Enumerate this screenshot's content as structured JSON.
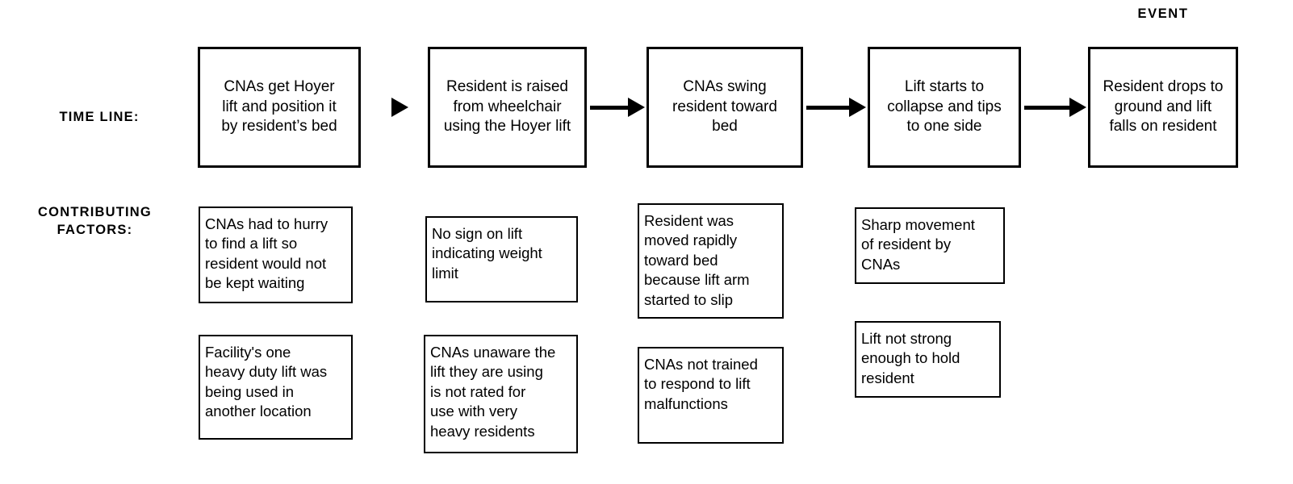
{
  "diagram": {
    "title_caption": "EVENT",
    "row_labels": {
      "timeline": "TIME LINE:",
      "contributing_factors": "CONTRIBUTING\nFACTORS:"
    },
    "colors": {
      "background": "#ffffff",
      "stroke": "#000000",
      "text": "#000000"
    },
    "timeline": {
      "steps": [
        {
          "id": "step-1",
          "text": "CNAs get Hoyer\nlift and position it\nby resident’s bed"
        },
        {
          "id": "step-2",
          "text": "Resident is raised\nfrom wheelchair\nusing the Hoyer lift"
        },
        {
          "id": "step-3",
          "text": "CNAs swing\nresident toward\nbed"
        },
        {
          "id": "step-4",
          "text": "Lift starts to\ncollapse and tips\nto one side"
        },
        {
          "id": "step-5",
          "text": "Resident drops to\nground and lift\nfalls on resident"
        }
      ],
      "connectors": [
        {
          "id": "arrow-1",
          "type": "arrowhead-only"
        },
        {
          "id": "arrow-2",
          "type": "line-arrow"
        },
        {
          "id": "arrow-3",
          "type": "line-arrow"
        },
        {
          "id": "arrow-4",
          "type": "line-arrow"
        }
      ]
    },
    "contributing_factors": {
      "columns": [
        {
          "column": 1,
          "boxes": [
            {
              "id": "cf-1-1",
              "text": "CNAs had to hurry\nto find a lift so\nresident would not\nbe kept waiting"
            },
            {
              "id": "cf-1-2",
              "text": "Facility's one\nheavy duty lift was\nbeing used in\nanother location"
            }
          ]
        },
        {
          "column": 2,
          "boxes": [
            {
              "id": "cf-2-1",
              "text": "No sign on lift\nindicating weight\nlimit"
            },
            {
              "id": "cf-2-2",
              "text": "CNAs unaware the\nlift they are using\nis not rated for\nuse with very\nheavy residents"
            }
          ]
        },
        {
          "column": 3,
          "boxes": [
            {
              "id": "cf-3-1",
              "text": "Resident was\nmoved rapidly\ntoward bed\nbecause lift arm\nstarted to slip"
            },
            {
              "id": "cf-3-2",
              "text": "CNAs not trained\nto respond to lift\nmalfunctions"
            }
          ]
        },
        {
          "column": 4,
          "boxes": [
            {
              "id": "cf-4-1",
              "text": "Sharp movement\nof resident by\nCNAs"
            },
            {
              "id": "cf-4-2",
              "text": "Lift not strong\nenough to hold\nresident"
            }
          ]
        }
      ]
    }
  }
}
